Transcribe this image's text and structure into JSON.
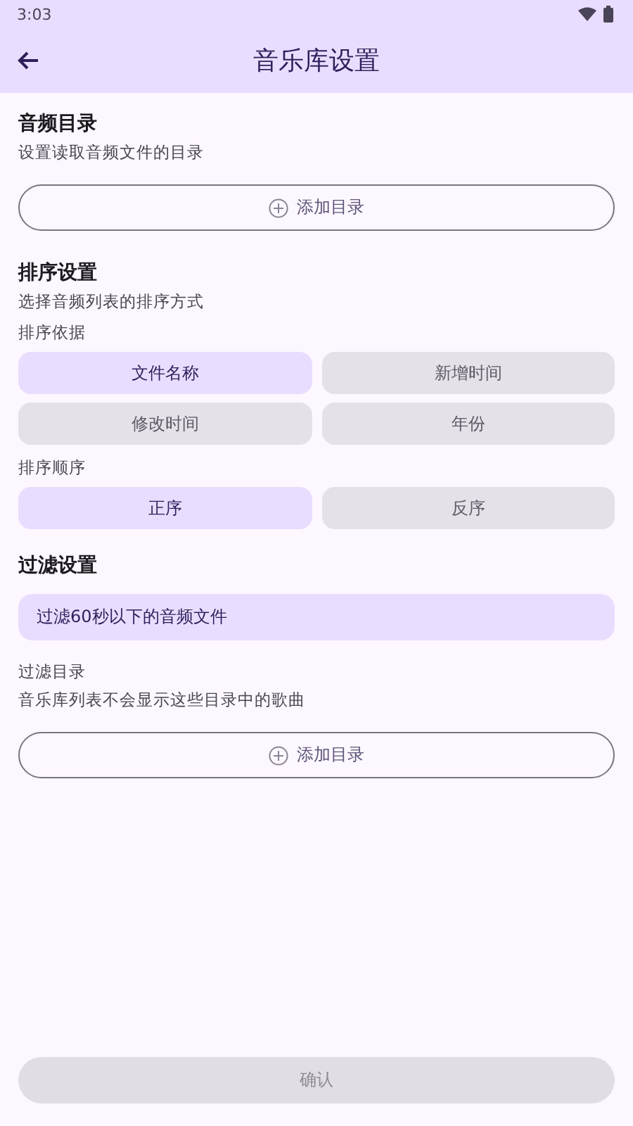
{
  "status_bar": {
    "time": "3:03"
  },
  "app_bar": {
    "title": "音乐库设置"
  },
  "audio_dirs": {
    "title": "音频目录",
    "description": "设置读取音频文件的目录",
    "add_button": "添加目录"
  },
  "sort": {
    "title": "排序设置",
    "description": "选择音频列表的排序方式",
    "by_label": "排序依据",
    "by_options": [
      {
        "label": "文件名称",
        "selected": true
      },
      {
        "label": "新增时间",
        "selected": false
      },
      {
        "label": "修改时间",
        "selected": false
      },
      {
        "label": "年份",
        "selected": false
      }
    ],
    "order_label": "排序顺序",
    "order_options": [
      {
        "label": "正序",
        "selected": true
      },
      {
        "label": "反序",
        "selected": false
      }
    ]
  },
  "filter": {
    "title": "过滤设置",
    "short_files": {
      "label": "过滤60秒以下的音频文件",
      "on": true
    },
    "dirs_label": "过滤目录",
    "dirs_description": "音乐库列表不会显示这些目录中的歌曲",
    "add_button": "添加目录"
  },
  "confirm": {
    "label": "确认",
    "disabled": true
  }
}
